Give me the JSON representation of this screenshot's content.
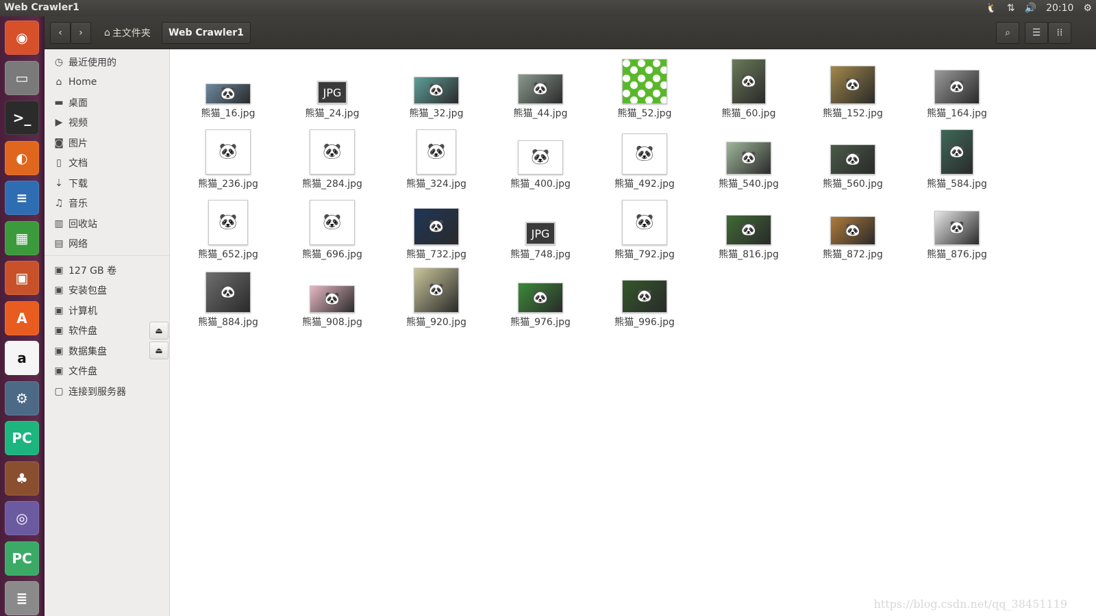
{
  "topbar": {
    "window_title": "Web Crawler1",
    "clock": "20:10",
    "icons": [
      "tux-icon",
      "network-icon",
      "volume-icon",
      "settings-gear-icon"
    ]
  },
  "launcher": {
    "apps": [
      {
        "name": "ubuntu-dash",
        "glyph": "◉"
      },
      {
        "name": "files",
        "glyph": "▭"
      },
      {
        "name": "terminal",
        "glyph": ">_"
      },
      {
        "name": "firefox",
        "glyph": "◐"
      },
      {
        "name": "libreoffice-writer",
        "glyph": "≡"
      },
      {
        "name": "libreoffice-calc",
        "glyph": "▦"
      },
      {
        "name": "libreoffice-impress",
        "glyph": "▣"
      },
      {
        "name": "software-center",
        "glyph": "A"
      },
      {
        "name": "amazon",
        "glyph": "a"
      },
      {
        "name": "system-settings",
        "glyph": "⚙"
      },
      {
        "name": "pycharm",
        "glyph": "PC"
      },
      {
        "name": "playonlinux",
        "glyph": "♣"
      },
      {
        "name": "disk-image",
        "glyph": "◎"
      },
      {
        "name": "pycharm-stack",
        "glyph": "PC"
      },
      {
        "name": "workspace-stack",
        "glyph": "≣"
      }
    ]
  },
  "header": {
    "breadcrumb_home": "主文件夹",
    "breadcrumb_current": "Web Crawler1"
  },
  "sidebar": {
    "places": [
      {
        "label": "最近使用的",
        "icon": "clock-icon",
        "glyph": "◷"
      },
      {
        "label": "Home",
        "icon": "home-icon",
        "glyph": "⌂"
      },
      {
        "label": "桌面",
        "icon": "folder-icon",
        "glyph": "▬"
      },
      {
        "label": "视频",
        "icon": "video-icon",
        "glyph": "▶"
      },
      {
        "label": "图片",
        "icon": "camera-icon",
        "glyph": "◙"
      },
      {
        "label": "文档",
        "icon": "document-icon",
        "glyph": "▯"
      },
      {
        "label": "下载",
        "icon": "download-icon",
        "glyph": "⇣"
      },
      {
        "label": "音乐",
        "icon": "music-icon",
        "glyph": "♫"
      },
      {
        "label": "回收站",
        "icon": "trash-icon",
        "glyph": "▥"
      },
      {
        "label": "网络",
        "icon": "network-icon",
        "glyph": "▤"
      }
    ],
    "devices": [
      {
        "label": "127 GB 卷",
        "icon": "drive-icon",
        "glyph": "▣",
        "eject": false
      },
      {
        "label": "安装包盘",
        "icon": "drive-icon",
        "glyph": "▣",
        "eject": false
      },
      {
        "label": "计算机",
        "icon": "drive-icon",
        "glyph": "▣",
        "eject": false
      },
      {
        "label": "软件盘",
        "icon": "drive-icon",
        "glyph": "▣",
        "eject": true
      },
      {
        "label": "数据集盘",
        "icon": "drive-icon",
        "glyph": "▣",
        "eject": true
      },
      {
        "label": "文件盘",
        "icon": "drive-icon",
        "glyph": "▣",
        "eject": false
      },
      {
        "label": "连接到服务器",
        "icon": "server-icon",
        "glyph": "▢",
        "eject": false
      }
    ],
    "eject_glyph": "⏏"
  },
  "files": [
    {
      "name": "熊猫_16.jpg",
      "kind": "photo",
      "color": "#6d8aa0"
    },
    {
      "name": "熊猫_24.jpg",
      "kind": "generic",
      "label": "JPG"
    },
    {
      "name": "熊猫_32.jpg",
      "kind": "photo",
      "color": "#5f9f9a"
    },
    {
      "name": "熊猫_44.jpg",
      "kind": "photo",
      "color": "#8a9a8e"
    },
    {
      "name": "熊猫_52.jpg",
      "kind": "pattern",
      "color": "#59b82a"
    },
    {
      "name": "熊猫_60.jpg",
      "kind": "photo",
      "color": "#6a7a58"
    },
    {
      "name": "熊猫_152.jpg",
      "kind": "photo",
      "color": "#a2884a"
    },
    {
      "name": "熊猫_164.jpg",
      "kind": "photo",
      "color": "#9a9a9a"
    },
    {
      "name": "熊猫_236.jpg",
      "kind": "cartoon",
      "color": "#ffffff"
    },
    {
      "name": "熊猫_284.jpg",
      "kind": "cartoon",
      "color": "#ffffff"
    },
    {
      "name": "熊猫_324.jpg",
      "kind": "cartoon",
      "color": "#ffffff"
    },
    {
      "name": "熊猫_400.jpg",
      "kind": "cartoon",
      "color": "#ffffff"
    },
    {
      "name": "熊猫_492.jpg",
      "kind": "cartoon",
      "color": "#ffffff"
    },
    {
      "name": "熊猫_540.jpg",
      "kind": "photo",
      "color": "#9fb79a"
    },
    {
      "name": "熊猫_560.jpg",
      "kind": "photo",
      "color": "#4a5a48"
    },
    {
      "name": "熊猫_584.jpg",
      "kind": "photo",
      "color": "#3e6a5a"
    },
    {
      "name": "熊猫_652.jpg",
      "kind": "cartoon",
      "color": "#ffffff"
    },
    {
      "name": "熊猫_696.jpg",
      "kind": "cartoon",
      "color": "#ffffff"
    },
    {
      "name": "熊猫_732.jpg",
      "kind": "photo",
      "color": "#1f3658"
    },
    {
      "name": "熊猫_748.jpg",
      "kind": "generic",
      "label": "JPG"
    },
    {
      "name": "熊猫_792.jpg",
      "kind": "cartoon",
      "color": "#ffffff"
    },
    {
      "name": "熊猫_816.jpg",
      "kind": "photo",
      "color": "#3f6a34"
    },
    {
      "name": "熊猫_872.jpg",
      "kind": "photo",
      "color": "#b07a3a"
    },
    {
      "name": "熊猫_876.jpg",
      "kind": "photo",
      "color": "#e8e8e8"
    },
    {
      "name": "熊猫_884.jpg",
      "kind": "photo",
      "color": "#6e6e6e"
    },
    {
      "name": "熊猫_908.jpg",
      "kind": "photo",
      "color": "#e7b7c4"
    },
    {
      "name": "熊猫_920.jpg",
      "kind": "photo",
      "color": "#c9c59a"
    },
    {
      "name": "熊猫_976.jpg",
      "kind": "photo",
      "color": "#3c8a3a"
    },
    {
      "name": "熊猫_996.jpg",
      "kind": "photo",
      "color": "#33582a"
    }
  ],
  "watermark": "https://blog.csdn.net/qq_38451119"
}
